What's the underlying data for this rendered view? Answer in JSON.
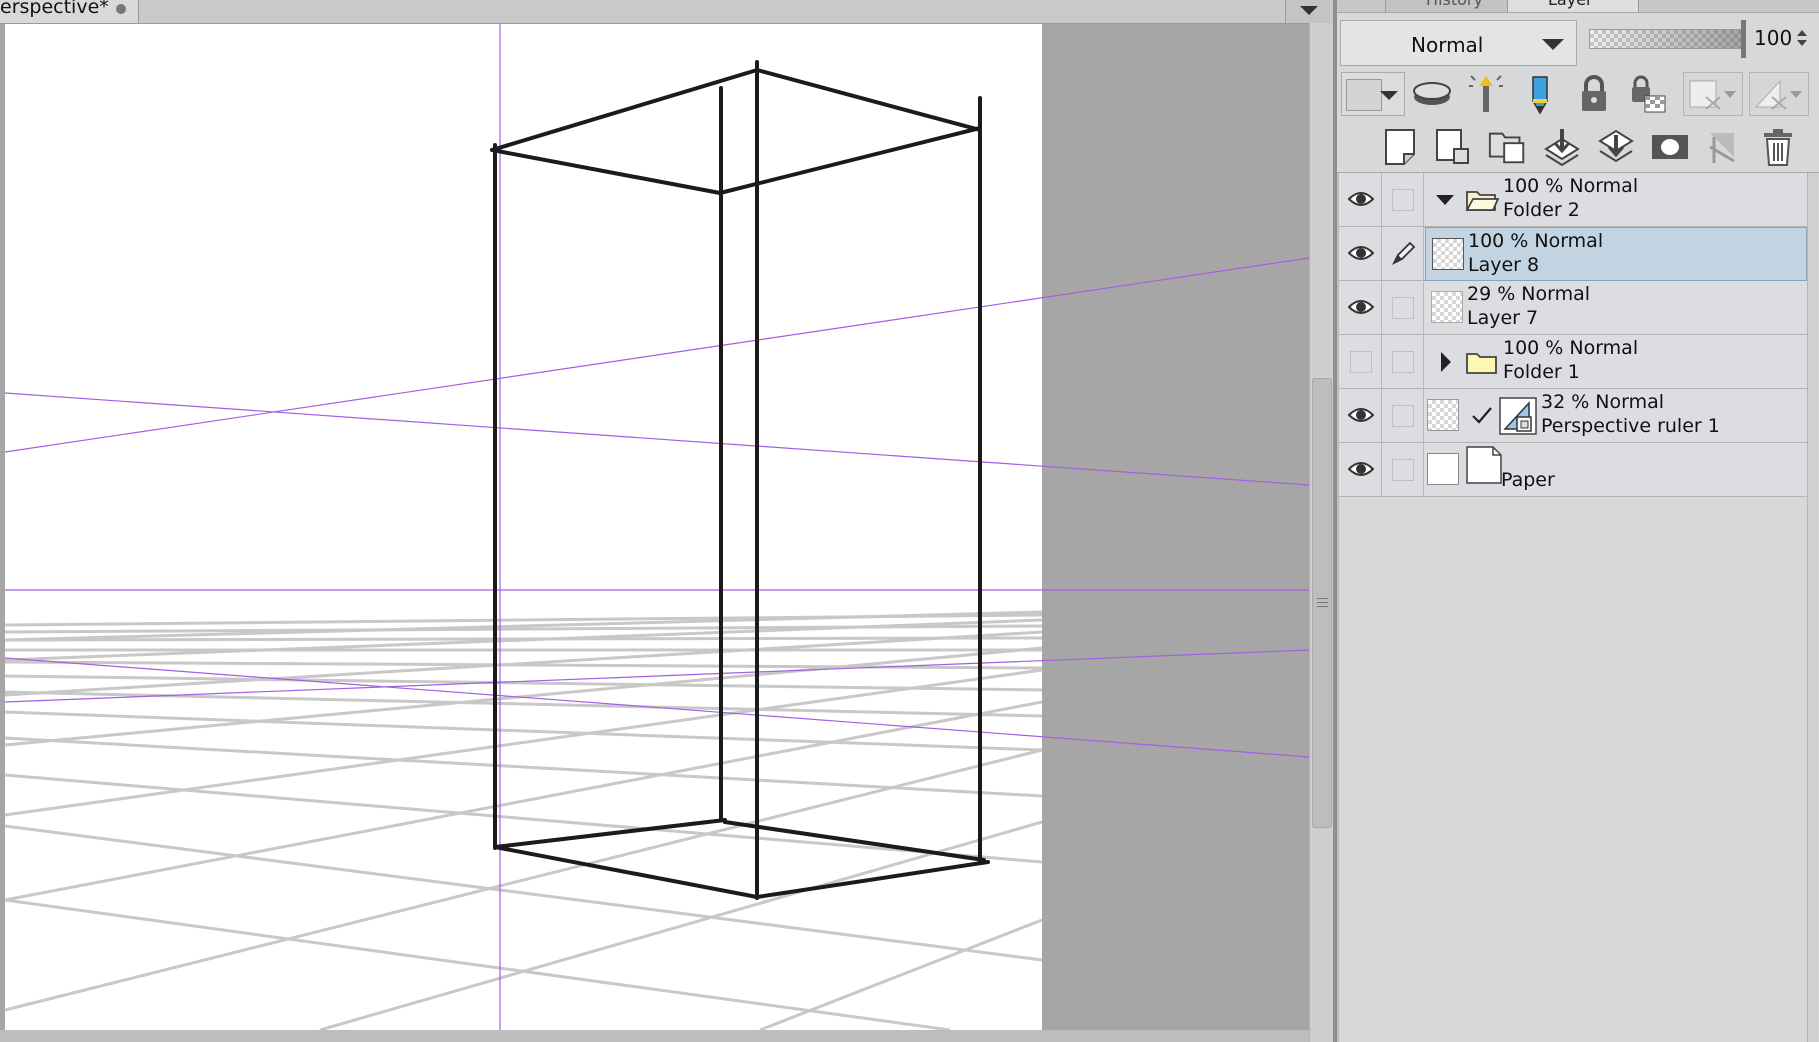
{
  "document": {
    "tab_title": "erspective*"
  },
  "panel_tabs": {
    "history": "History",
    "layer": "Layer"
  },
  "layer_properties": {
    "blend_mode": "Normal",
    "opacity": "100"
  },
  "icons": {
    "tab_menu": "chevron-down-icon",
    "eye": "eye-icon",
    "pen": "pen-icon",
    "folder": "folder-icon",
    "ruler": "perspective-ruler-icon",
    "check": "check-icon"
  },
  "layers": [
    {
      "opacity": "100 %",
      "blend": "Normal",
      "name": "Folder 2",
      "visible": true,
      "type": "folder",
      "expanded": true
    },
    {
      "opacity": "100 %",
      "blend": "Normal",
      "name": "Layer 8",
      "visible": true,
      "type": "raster",
      "selected": true,
      "editing": true
    },
    {
      "opacity": "29 %",
      "blend": "Normal",
      "name": "Layer 7",
      "visible": true,
      "type": "raster"
    },
    {
      "opacity": "100 %",
      "blend": "Normal",
      "name": "Folder 1",
      "visible": false,
      "type": "folder",
      "expanded": false
    },
    {
      "opacity": "32 %",
      "blend": "Normal",
      "name": "Perspective ruler 1",
      "visible": true,
      "type": "ruler"
    },
    {
      "opacity": "",
      "blend": "",
      "name": "Paper",
      "visible": true,
      "type": "paper"
    }
  ],
  "colors": {
    "selected_row": "#c2d4e2",
    "guide_line": "#a45fe0",
    "canvas_bg": "#a6a6a6"
  }
}
